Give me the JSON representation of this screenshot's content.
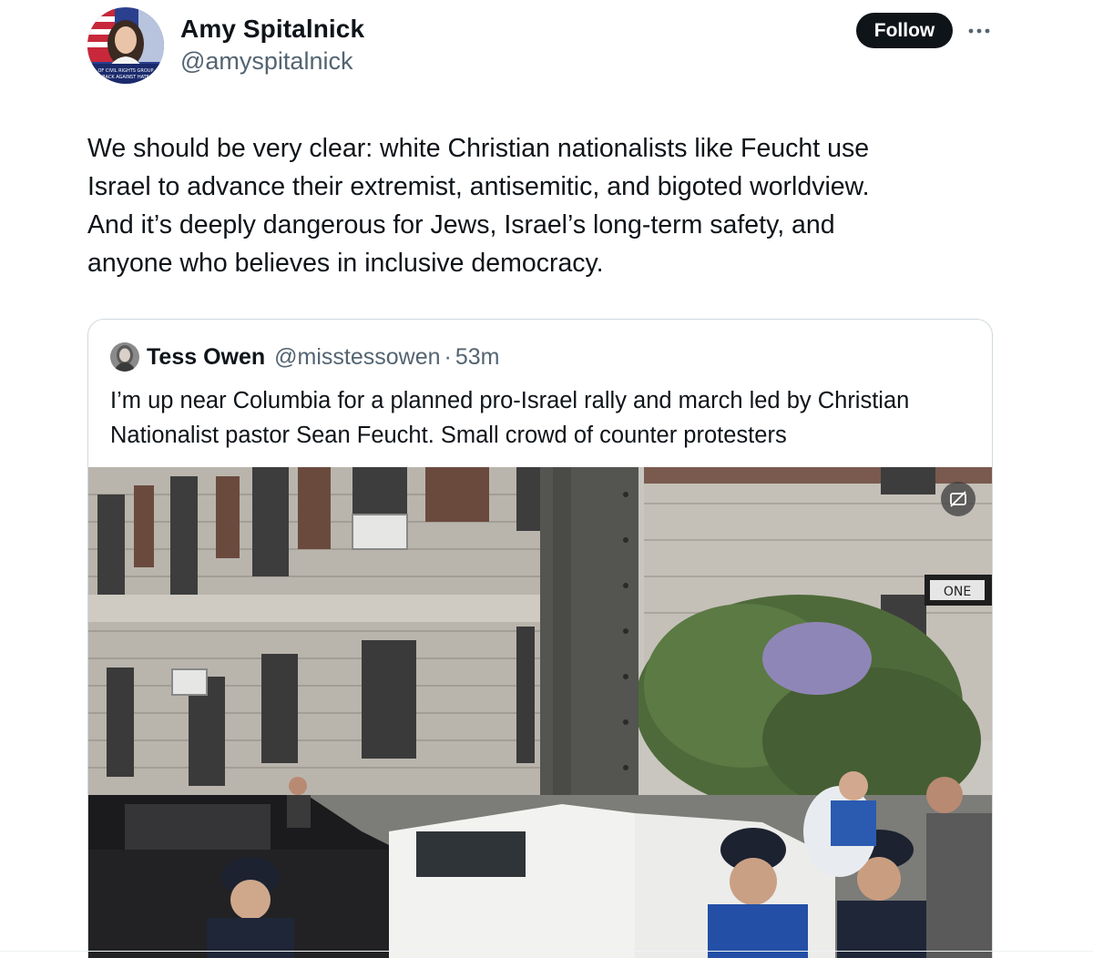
{
  "post": {
    "author": {
      "display_name": "Amy Spitalnick",
      "handle": "@amyspitalnick",
      "avatar_caption": "OF CIVIL RIGHTS GROUP BACK AGAINST HATE"
    },
    "follow_label": "Follow",
    "more_icon": "ellipsis-icon",
    "text": "We should be very clear: white Christian nationalists like Feucht use\nIsrael to advance their extremist, antisemitic, and bigoted worldview.\nAnd it’s deeply dangerous for Jews, Israel’s long-term safety, and\nanyone who believes in inclusive democracy."
  },
  "quoted_post": {
    "author": {
      "display_name": "Tess Owen",
      "handle": "@misstessowen"
    },
    "separator": "·",
    "time_ago": "53m",
    "text": "I’m up near Columbia for a planned pro-Israel rally and march led by Christian Nationalist pastor Sean Feucht. Small crowd of counter protesters",
    "media": {
      "type": "video",
      "street_sign_text": "ONE",
      "badge_icon": "sensitive-media-icon"
    }
  },
  "colors": {
    "text_primary": "#0f1419",
    "text_secondary": "#536471",
    "border": "#cfd9de",
    "follow_bg": "#0f1419",
    "follow_text": "#ffffff"
  }
}
